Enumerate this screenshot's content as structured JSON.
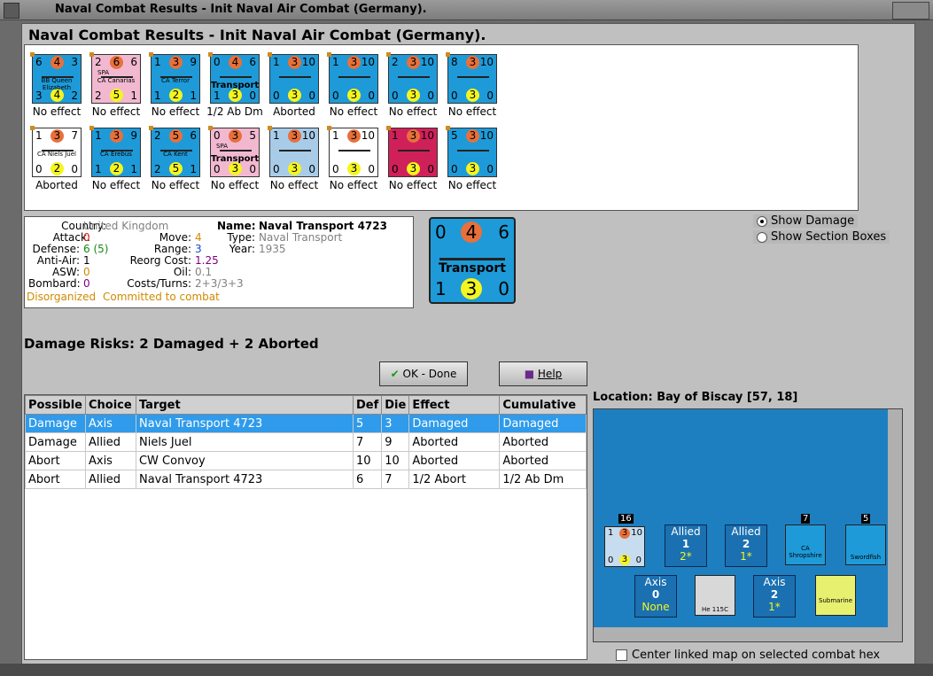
{
  "window_title": "Naval Combat Results - Init Naval Air Combat (Germany).",
  "heading": "Naval Combat Results - Init Naval Air Combat (Germany).",
  "units_row1": [
    {
      "tl": "6",
      "tc": "4",
      "tr": "3",
      "bl": "3",
      "bc": "4",
      "br": "2",
      "name": "BB Queen Elizabeth",
      "result": "No effect",
      "bg": "#1e9ad8"
    },
    {
      "tl": "2",
      "tc": "6",
      "tr": "6",
      "bl": "2",
      "bc": "5",
      "br": "1",
      "name": "CA Canarias",
      "extra": "SPA",
      "result": "No effect",
      "bg": "#f2b8d0"
    },
    {
      "tl": "1",
      "tc": "3",
      "tr": "9",
      "bl": "1",
      "bc": "2",
      "br": "1",
      "name": "CA Terror",
      "result": "No effect",
      "bg": "#1e9ad8"
    },
    {
      "tl": "0",
      "tc": "4",
      "tr": "6",
      "bl": "1",
      "bc": "3",
      "br": "0",
      "name": "Transport",
      "result": "1/2 Ab Dm",
      "bg": "#1e9ad8"
    },
    {
      "tl": "1",
      "tc": "3",
      "tr": "10",
      "bl": "0",
      "bc": "3",
      "br": "0",
      "name": "",
      "result": "Aborted",
      "bg": "#1e9ad8"
    },
    {
      "tl": "1",
      "tc": "3",
      "tr": "10",
      "bl": "0",
      "bc": "3",
      "br": "0",
      "name": "",
      "result": "No effect",
      "bg": "#1e9ad8"
    },
    {
      "tl": "2",
      "tc": "3",
      "tr": "10",
      "bl": "0",
      "bc": "3",
      "br": "0",
      "name": "",
      "result": "No effect",
      "bg": "#1e9ad8"
    },
    {
      "tl": "8",
      "tc": "3",
      "tr": "10",
      "bl": "0",
      "bc": "3",
      "br": "0",
      "name": "",
      "result": "No effect",
      "bg": "#1e9ad8"
    }
  ],
  "units_row2": [
    {
      "tl": "1",
      "tc": "3",
      "tr": "7",
      "bl": "0",
      "bc": "2",
      "br": "0",
      "name": "CA Niels Juel",
      "result": "Aborted",
      "bg": "#ffffff"
    },
    {
      "tl": "1",
      "tc": "3",
      "tr": "9",
      "bl": "1",
      "bc": "2",
      "br": "1",
      "name": "CA Erebus",
      "result": "No effect",
      "bg": "#1e9ad8"
    },
    {
      "tl": "2",
      "tc": "5",
      "tr": "6",
      "bl": "2",
      "bc": "5",
      "br": "1",
      "name": "CA Kent",
      "result": "No effect",
      "bg": "#1e9ad8"
    },
    {
      "tl": "0",
      "tc": "3",
      "tr": "5",
      "bl": "0",
      "bc": "3",
      "br": "0",
      "name": "Transport",
      "extra": "SPA",
      "result": "No effect",
      "bg": "#f2b8d0"
    },
    {
      "tl": "1",
      "tc": "3",
      "tr": "10",
      "bl": "0",
      "bc": "3",
      "br": "0",
      "name": "",
      "result": "No effect",
      "bg": "#a8cce8"
    },
    {
      "tl": "1",
      "tc": "3",
      "tr": "10",
      "bl": "0",
      "bc": "3",
      "br": "0",
      "name": "",
      "result": "No effect",
      "bg": "#ffffff"
    },
    {
      "tl": "1",
      "tc": "3",
      "tr": "10",
      "bl": "0",
      "bc": "3",
      "br": "0",
      "name": "",
      "result": "No effect",
      "bg": "#d0205a"
    },
    {
      "tl": "5",
      "tc": "3",
      "tr": "10",
      "bl": "0",
      "bc": "3",
      "br": "0",
      "name": "",
      "result": "No effect",
      "bg": "#1e9ad8"
    }
  ],
  "info": {
    "country_label": "Country:",
    "country": "United Kingdom",
    "attack_label": "Attack:",
    "attack": "0",
    "defense_label": "Defense:",
    "defense": "6 (5)",
    "antiair_label": "Anti-Air:",
    "antiair": "1",
    "asw_label": "ASW:",
    "asw": "0",
    "bombard_label": "Bombard:",
    "bombard": "0",
    "name_label": "Name:",
    "name": "Naval Transport 4723",
    "type_label": "Type:",
    "type": "Naval Transport",
    "year_label": "Year:",
    "year": "1935",
    "move_label": "Move:",
    "move": "4",
    "range_label": "Range:",
    "range": "3",
    "reorg_label": "Reorg Cost:",
    "reorg": "1.25",
    "oil_label": "Oil:",
    "oil": "0.1",
    "costs_label": "Costs/Turns:",
    "costs": "2+3/3+3",
    "status1": "Disorganized",
    "status2": "Committed to combat"
  },
  "big_counter": {
    "tl": "0",
    "tc": "4",
    "tr": "6",
    "bl": "1",
    "bc": "3",
    "br": "0",
    "name": "Transport"
  },
  "radios": {
    "show_damage": "Show Damage",
    "show_sections": "Show Section Boxes"
  },
  "damage_risks": "Damage Risks:  2 Damaged + 2 Aborted",
  "buttons": {
    "ok": "OK - Done",
    "help": "Help"
  },
  "table": {
    "headers": [
      "Possible",
      "Choice",
      "Target",
      "Def",
      "Die",
      "Effect",
      "Cumulative"
    ],
    "rows": [
      [
        "Damage",
        "Axis",
        " Naval Transport 4723",
        "5",
        "3",
        "Damaged",
        "Damaged"
      ],
      [
        "Damage",
        "Allied",
        " Niels Juel",
        "7",
        "9",
        "Aborted",
        "Aborted"
      ],
      [
        "Abort",
        "Axis",
        "CW Convoy",
        "10",
        "10",
        "Aborted",
        "Aborted"
      ],
      [
        "Abort",
        "Allied",
        " Naval Transport 4723",
        "6",
        "7",
        "1/2 Abort",
        "1/2 Ab Dm"
      ]
    ]
  },
  "location": "Location:  Bay of Biscay [57, 18]",
  "map": {
    "allied1": {
      "label": "Allied",
      "num": "1",
      "sub": "2*"
    },
    "allied2": {
      "label": "Allied",
      "num": "2",
      "sub": "1*"
    },
    "axis0": {
      "label": "Axis",
      "num": "0",
      "sub": "None"
    },
    "axis2": {
      "label": "Axis",
      "num": "2",
      "sub": "1*"
    },
    "stack16": "16",
    "stack7": "7",
    "stack5": "5",
    "ca_shropshire": "CA Shropshire",
    "swordfish": "Swordfish",
    "he115": "He 115C",
    "submarine": "Submarine"
  },
  "center_linked": "Center linked map on selected combat hex"
}
